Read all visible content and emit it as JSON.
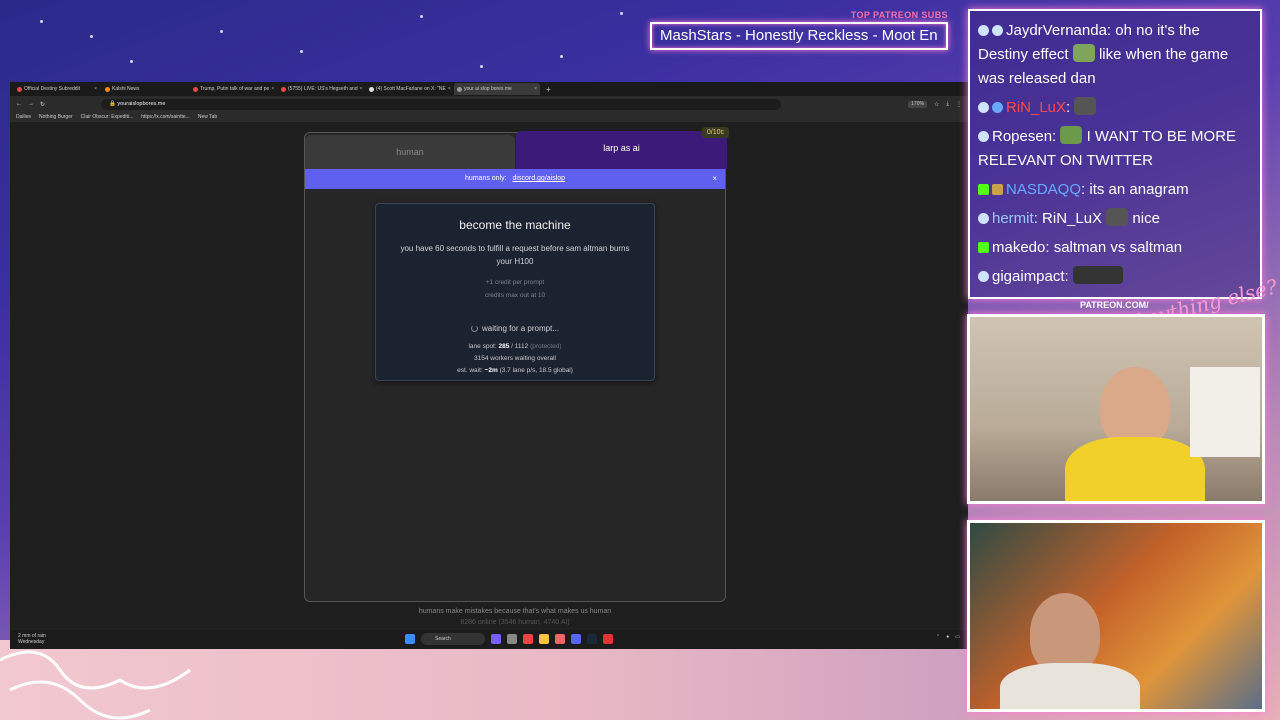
{
  "overlay": {
    "sub_label": "TOP PATREON SUBS",
    "sub_name": "MashStars - Honestly Reckless - Moot En",
    "patreon_url": "PATREON.COM/"
  },
  "browser": {
    "tabs": [
      {
        "label": "Official Destiny Subreddit"
      },
      {
        "label": "Kalshi News"
      },
      {
        "label": "Trump, Putin talk of war and pe"
      },
      {
        "label": "(5755) LIVE: US's Hegseth and"
      },
      {
        "label": "(4) Scott MacFarlane on X: \"NE"
      },
      {
        "label": "your ai slop bores me"
      }
    ],
    "url": "youraislopbores.me",
    "zoom": "170%",
    "bookmarks": [
      "Dailies",
      "Nothing Burger",
      "Clair Obscur: Expediti...",
      "https://x.com/saintte...",
      "New Tab"
    ]
  },
  "app": {
    "tab_human": "human",
    "tab_ai": "larp as ai",
    "credits": "0/10c",
    "banner_text": "humans only:",
    "banner_link": "discord.gg/aislop",
    "banner_close": "×",
    "title": "become the machine",
    "description": "you have 60 seconds to fulfill a request before sam altman burns your H100",
    "credit_line1": "+1 credit per prompt",
    "credit_line2": "credits max out at 10",
    "waiting": "waiting for a prompt...",
    "lane_prefix": "lane spot:",
    "lane_spot": "285",
    "lane_total": "/ 1112",
    "lane_note": "(protected)",
    "workers": "3154 workers waiting overall",
    "est_prefix": "est. wait:",
    "est_value": "~2m",
    "est_note": "(3.7 lane p/s, 18.5 global)",
    "footer1": "humans make mistakes because that's what makes us human",
    "footer2": "8286 online (3546 human, 4740 AI)"
  },
  "taskbar": {
    "weather1": "2 mm of rain",
    "weather2": "Wednesday",
    "search": "Search"
  },
  "chat": [
    {
      "user": "JaydrVernanda",
      "text": "oh no it's the Destiny effect",
      "text2": "like when the game was released dan"
    },
    {
      "user": "RiN_LuX",
      "text": ""
    },
    {
      "user": "Ropesen",
      "text": "I WANT TO BE MORE RELEVANT ON TWITTER"
    },
    {
      "user": "NASDAQQ",
      "text": "its an anagram"
    },
    {
      "user": "hermit",
      "text": "RiN_LuX",
      "text2": "nice"
    },
    {
      "user": "makedo",
      "text": "saltman vs saltman"
    },
    {
      "user": "gigaimpact",
      "text": ""
    }
  ],
  "colors": {
    "accent_tab": "#3b1a7a",
    "banner": "#6060f0",
    "neon_border": "#ff7ad9"
  }
}
